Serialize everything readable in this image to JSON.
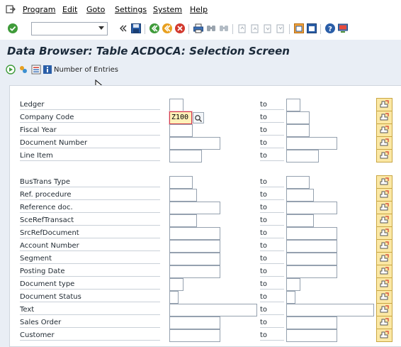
{
  "menubar": {
    "items": [
      "Program",
      "Edit",
      "Goto",
      "Settings",
      "System",
      "Help"
    ]
  },
  "toolbar": {
    "command_value": ""
  },
  "screen": {
    "title": "Data Browser: Table ACDOCA: Selection Screen",
    "number_of_entries_label": "Number of Entries"
  },
  "form": {
    "to_label": "to",
    "rows": [
      {
        "label": "Ledger",
        "low": "",
        "high": ""
      },
      {
        "label": "Company Code",
        "low": "Z100",
        "high": ""
      },
      {
        "label": "Fiscal Year",
        "low": "",
        "high": ""
      },
      {
        "label": "Document Number",
        "low": "",
        "high": ""
      },
      {
        "label": "Line Item",
        "low": "",
        "high": ""
      },
      {
        "label": "BusTrans Type",
        "low": "",
        "high": ""
      },
      {
        "label": "Ref. procedure",
        "low": "",
        "high": ""
      },
      {
        "label": "Reference doc.",
        "low": "",
        "high": ""
      },
      {
        "label": "SceRefTransact",
        "low": "",
        "high": ""
      },
      {
        "label": "SrcRefDocument",
        "low": "",
        "high": ""
      },
      {
        "label": "Account Number",
        "low": "",
        "high": ""
      },
      {
        "label": "Segment",
        "low": "",
        "high": ""
      },
      {
        "label": "Posting Date",
        "low": "",
        "high": ""
      },
      {
        "label": "Document type",
        "low": "",
        "high": ""
      },
      {
        "label": "Document Status",
        "low": "",
        "high": ""
      },
      {
        "label": "Text",
        "low": "",
        "high": ""
      },
      {
        "label": "Sales Order",
        "low": "",
        "high": ""
      },
      {
        "label": "Customer",
        "low": "",
        "high": ""
      }
    ]
  },
  "colors": {
    "title_bg": "#e9eef5",
    "active_field_bg": "#fff1b8",
    "active_field_border": "#d2374b",
    "multisel_bg": "#fbe8a5"
  }
}
